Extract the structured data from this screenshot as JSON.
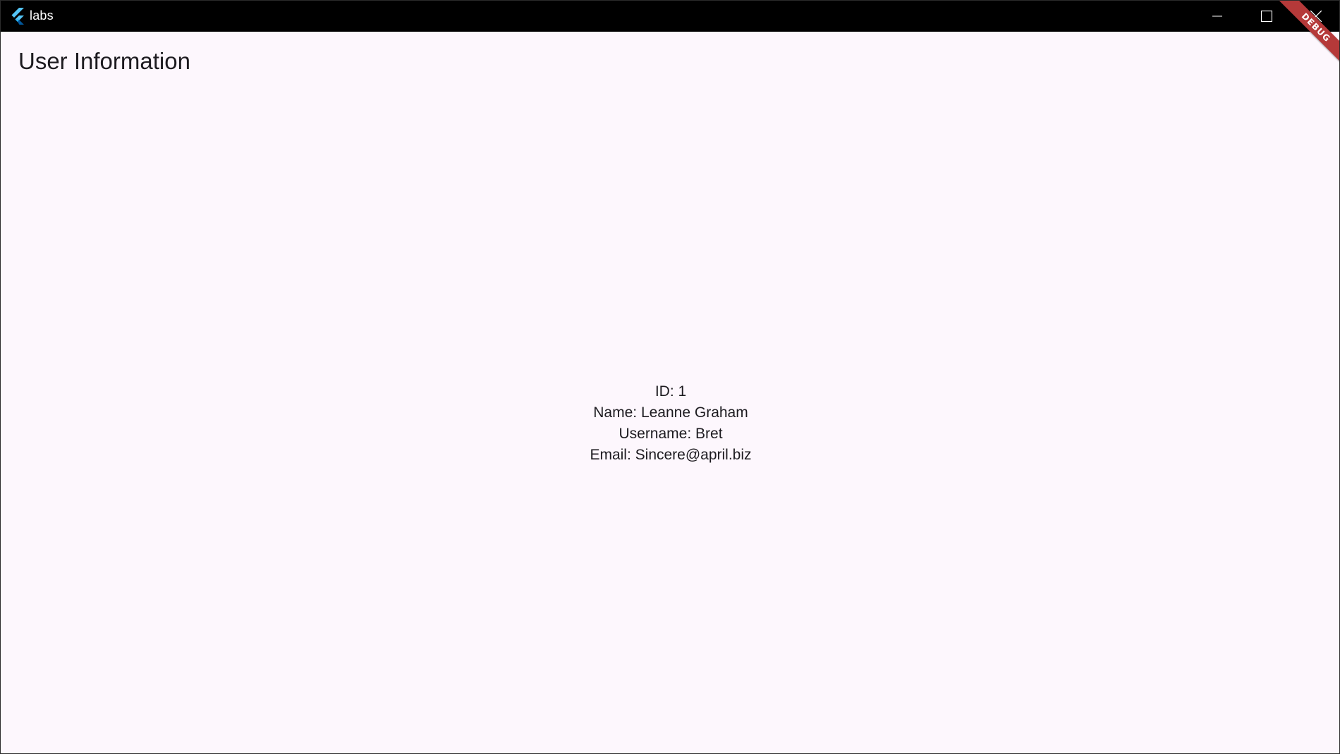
{
  "window": {
    "title": "labs",
    "controls": {
      "minimize_icon": "minimize-icon",
      "maximize_icon": "maximize-icon",
      "close_icon": "close-icon"
    }
  },
  "app_bar": {
    "title": "User Information"
  },
  "user": {
    "id_label": "ID: ",
    "id_value": "1",
    "name_label": "Name: ",
    "name_value": "Leanne Graham",
    "username_label": "Username: ",
    "username_value": "Bret",
    "email_label": "Email: ",
    "email_value": "Sincere@april.biz"
  },
  "debug_banner": {
    "label": "DEBUG",
    "color": "#b53939"
  },
  "colors": {
    "background": "#fdf7fd",
    "titlebar": "#000000",
    "text": "#1d1b20",
    "flutter_blue": "#42a5f5",
    "flutter_dark_blue": "#0d47a1"
  }
}
